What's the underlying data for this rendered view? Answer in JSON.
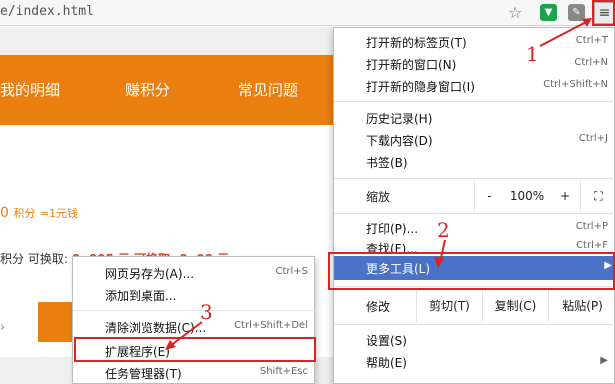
{
  "browser": {
    "url_fragment": "e/index.html",
    "icons": [
      "star-icon",
      "shield-extension-icon",
      "puzzle-extension-icon",
      "hamburger-menu-icon"
    ]
  },
  "page": {
    "nav": [
      "我的明细",
      "赚积分",
      "常见问题"
    ],
    "points_value": "0",
    "points_unit": "积分",
    "points_equiv": "=1元钱",
    "exchange_text": "积分  可换取:",
    "exchange_partial": "0 .005  元  可换取: 0 .00  元",
    "colors": {
      "accent": "#ea7f10",
      "highlight": "#4a73c8",
      "annotation": "#dd2222"
    }
  },
  "menu": {
    "items": [
      {
        "label": "打开新的标签页(T)",
        "shortcut": "Ctrl+T"
      },
      {
        "label": "打开新的窗口(N)",
        "shortcut": "Ctrl+N"
      },
      {
        "label": "打开新的隐身窗口(I)",
        "shortcut": "Ctrl+Shift+N"
      },
      {
        "label": "历史记录(H)",
        "shortcut": ""
      },
      {
        "label": "下载内容(D)",
        "shortcut": "Ctrl+J"
      },
      {
        "label": "书签(B)",
        "shortcut": ""
      }
    ],
    "zoom": {
      "label": "缩放",
      "minus": "-",
      "value": "100%",
      "plus": "+",
      "fullscreen": "⛶"
    },
    "print": {
      "label": "打印(P)...",
      "shortcut": "Ctrl+P"
    },
    "find": {
      "label": "查找(F)...",
      "shortcut": "Ctrl+F"
    },
    "more_tools": {
      "label": "更多工具(L)",
      "arrow": "▶"
    },
    "edit": {
      "label": "修改",
      "cut": "剪切(T)",
      "copy": "复制(C)",
      "paste": "粘贴(P)"
    },
    "settings": {
      "label": "设置(S)"
    },
    "help": {
      "label": "帮助(E)",
      "arrow": "▶"
    }
  },
  "submenu": {
    "items": [
      {
        "label": "网页另存为(A)...",
        "shortcut": "Ctrl+S"
      },
      {
        "label": "添加到桌面...",
        "shortcut": ""
      },
      {
        "label": "清除浏览数据(C)...",
        "shortcut": "Ctrl+Shift+Del"
      },
      {
        "label": "扩展程序(E)",
        "shortcut": ""
      },
      {
        "label": "任务管理器(T)",
        "shortcut": "Shift+Esc"
      }
    ]
  },
  "annotations": {
    "step1": "1",
    "step2": "2",
    "step3": "3"
  }
}
